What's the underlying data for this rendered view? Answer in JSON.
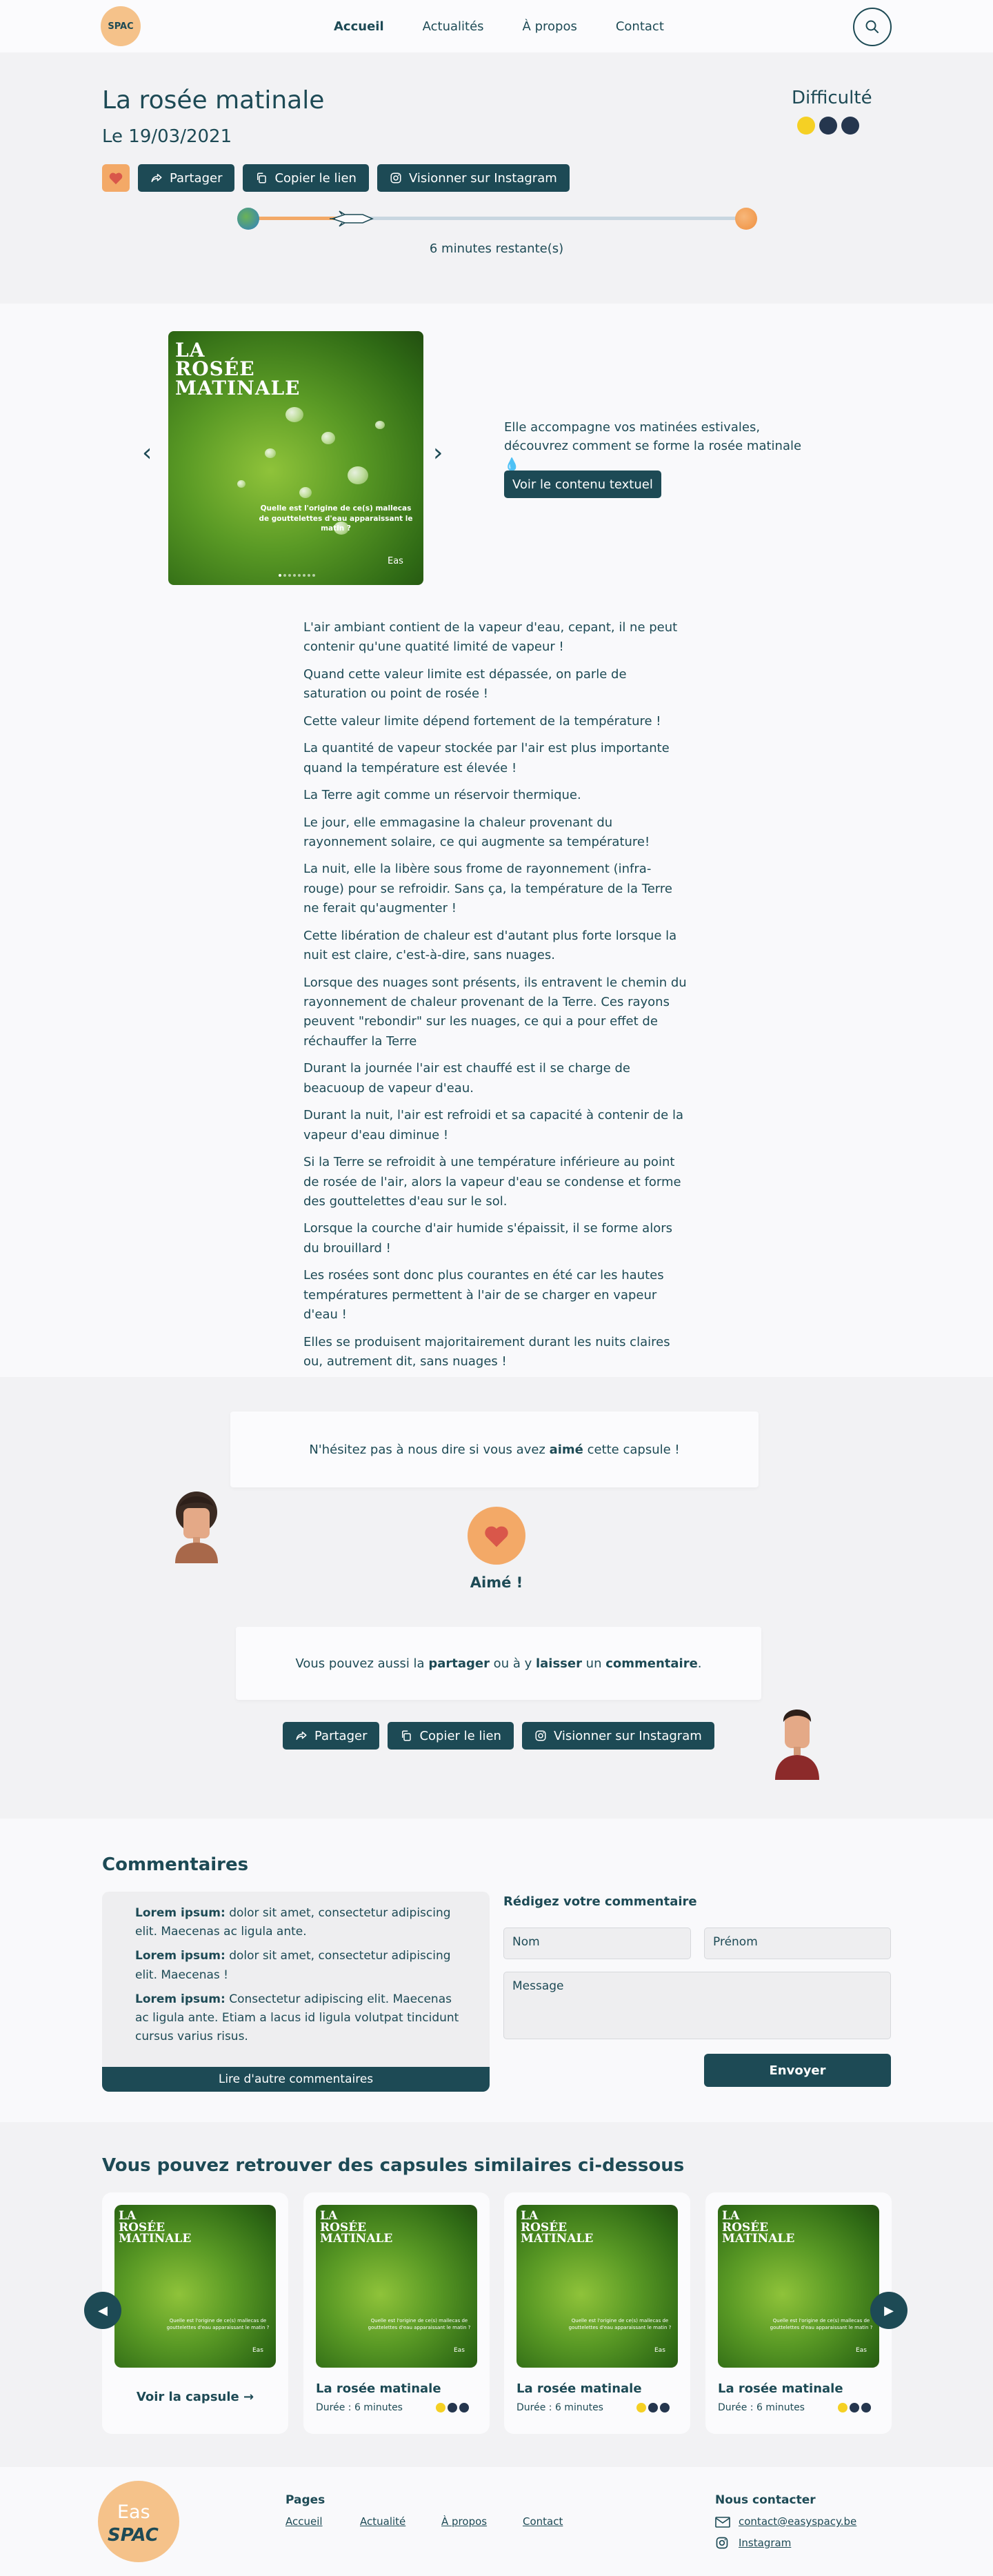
{
  "nav": {
    "logo_text": "SPAC",
    "links": [
      "Accueil",
      "Actualités",
      "À propos",
      "Contact"
    ]
  },
  "hero": {
    "title": "La rosée matinale",
    "date": "Le 19/03/2021",
    "difficulty_label": "Difficulté",
    "difficulty_level": 1,
    "difficulty_max": 3,
    "share_label": "Partager",
    "copy_label": "Copier le lien",
    "instagram_label": "Visionner sur Instagram",
    "progress_fraction": 0.22,
    "remaining": "6 minutes restante(s)"
  },
  "media": {
    "image_title_lines": [
      "LA",
      "ROSÉE",
      "MATINALE"
    ],
    "image_caption": "Quelle est l'origine de ce(s) mallecas de gouttelettes d'eau apparaissant le matin ?",
    "image_brand": "Eas",
    "description": "Elle accompagne vos matinées estivales, découvrez comment se forme la rosée matinale 💧",
    "text_button": "Voir le contenu textuel",
    "paragraphs": [
      "L'air ambiant contient de la vapeur d'eau, cepant, il ne peut contenir qu'une quatité limité de vapeur !",
      "Quand cette valeur limite est dépassée, on parle de saturation ou point de rosée !",
      "Cette valeur limite dépend fortement de la température !",
      "La quantité de vapeur stockée par l'air est plus importante quand la température est élevée !",
      "La Terre agit comme un réservoir thermique.",
      "Le jour, elle emmagasine la chaleur provenant du rayonnement solaire, ce qui augmente sa température!",
      "La nuit, elle la libère sous frome de rayonnement (infra-rouge) pour se refroidir. Sans ça, la température de la Terre ne ferait qu'augmenter !",
      "Cette libération de chaleur est d'autant plus forte lorsque la nuit est claire, c'est-à-dire, sans nuages.",
      "Lorsque des nuages sont présents, ils entravent le chemin du rayonnement de chaleur provenant de la Terre. Ces rayons peuvent \"rebondir\" sur les nuages, ce qui a pour effet de réchauffer la Terre",
      "Durant la journée l'air est chauffé  est il se charge de beacuoup de vapeur d'eau.",
      "Durant la nuit, l'air est refroidi et sa capacité à contenir de la vapeur d'eau diminue !",
      "Si la Terre se refroidit à une température inférieure au point de rosée de l'air, alors la vapeur d'eau se condense et forme des gouttelettes d'eau sur le sol.",
      "Lorsque la courche d'air humide s'épaissit, il se forme alors du brouillard !",
      "Les rosées sont donc plus courantes en été car les hautes températures permettent à l'air de se charger en vapeur d'eau !",
      "Elles se produisent majoritairement durant les nuits claires ou, autrement dit, sans nuages !"
    ]
  },
  "feedback": {
    "prompt_before": "N'hésitez pas à nous dire si vous avez ",
    "prompt_bold": "aimé",
    "prompt_after": " cette capsule !",
    "liked_label": "Aimé !",
    "share_before": "Vous pouvez aussi la ",
    "share_bold1": "partager",
    "share_mid1": " ou à y ",
    "share_bold2": "laisser",
    "share_mid2": " un ",
    "share_bold3": "commentaire",
    "share_after": ".",
    "share_label": "Partager",
    "copy_label": "Copier le lien",
    "instagram_label": "Visionner sur Instagram"
  },
  "comments": {
    "title": "Commentaires",
    "items": [
      {
        "author": "Lorem ipsum:",
        "text": " dolor sit amet, consectetur adipiscing elit. Maecenas ac ligula ante."
      },
      {
        "author": "Lorem ipsum:",
        "text": " dolor sit amet, consectetur adipiscing elit. Maecenas !"
      },
      {
        "author": "Lorem ipsum:",
        "text": "  Consectetur adipiscing elit. Maecenas ac ligula ante. Etiam a lacus id ligula volutpat tincidunt cursus varius risus."
      }
    ],
    "more_label": "Lire d'autre commentaires",
    "form_title": "Rédigez votre commentaire",
    "nom_placeholder": "Nom",
    "prenom_placeholder": "Prénom",
    "message_placeholder": "Message",
    "send_label": "Envoyer"
  },
  "similar": {
    "title": "Vous pouvez retrouver des capsules similaires ci-dessous",
    "see_label": "Voir la capsule →",
    "cards": [
      {
        "name": "La rosée matinale",
        "duration": "Durée : 6 minutes",
        "level": 1
      },
      {
        "name": "La rosée matinale",
        "duration": "Durée : 6 minutes",
        "level": 1
      },
      {
        "name": "La rosée matinale",
        "duration": "Durée : 6 minutes",
        "level": 1
      }
    ]
  },
  "footer": {
    "logo_top": "Eas",
    "logo_bottom": "SPAC",
    "pages_title": "Pages",
    "pages": [
      "Accueil",
      "Actualité",
      "À propos",
      "Contact"
    ],
    "contact_title": "Nous contacter",
    "email": "contact@easyspacy.be",
    "instagram": "Instagram"
  },
  "colors": {
    "primary": "#1d4a55",
    "accent": "#f3a967",
    "yellow": "#f5d024",
    "dark_dot": "#25364e"
  }
}
